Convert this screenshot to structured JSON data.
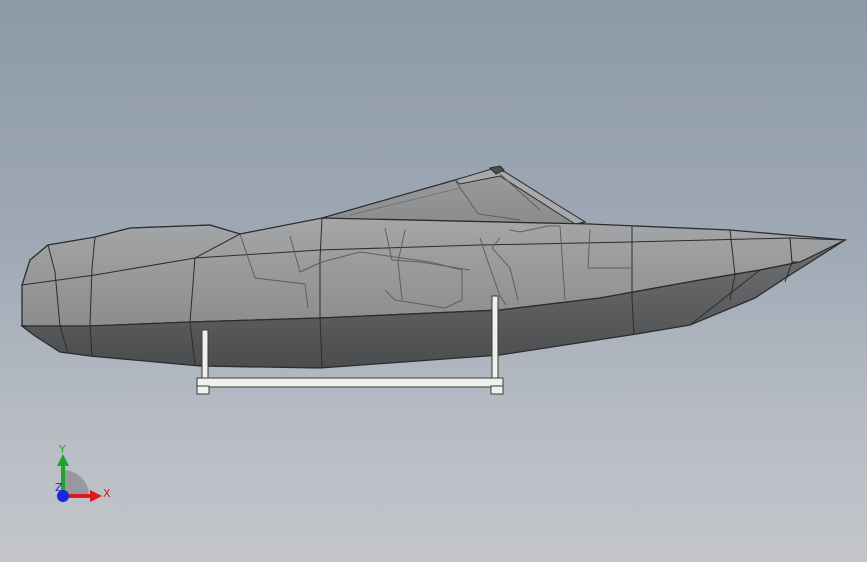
{
  "viewport": {
    "model_name": "speedboat-hull",
    "background_top": "#8e99a8",
    "background_bottom": "#c3c5ca"
  },
  "model": {
    "hull_color": "#8f9193",
    "hull_shadow_color": "#555759",
    "edge_color": "#2a2c2e",
    "inner_edge_color": "#5c5f62",
    "stand_color": "#f0f0ee"
  },
  "triad": {
    "x_label": "X",
    "y_label": "Y",
    "z_label": "Z",
    "x_color": "#e01919",
    "y_color": "#1fa52a",
    "z_color": "#1a28d8"
  }
}
